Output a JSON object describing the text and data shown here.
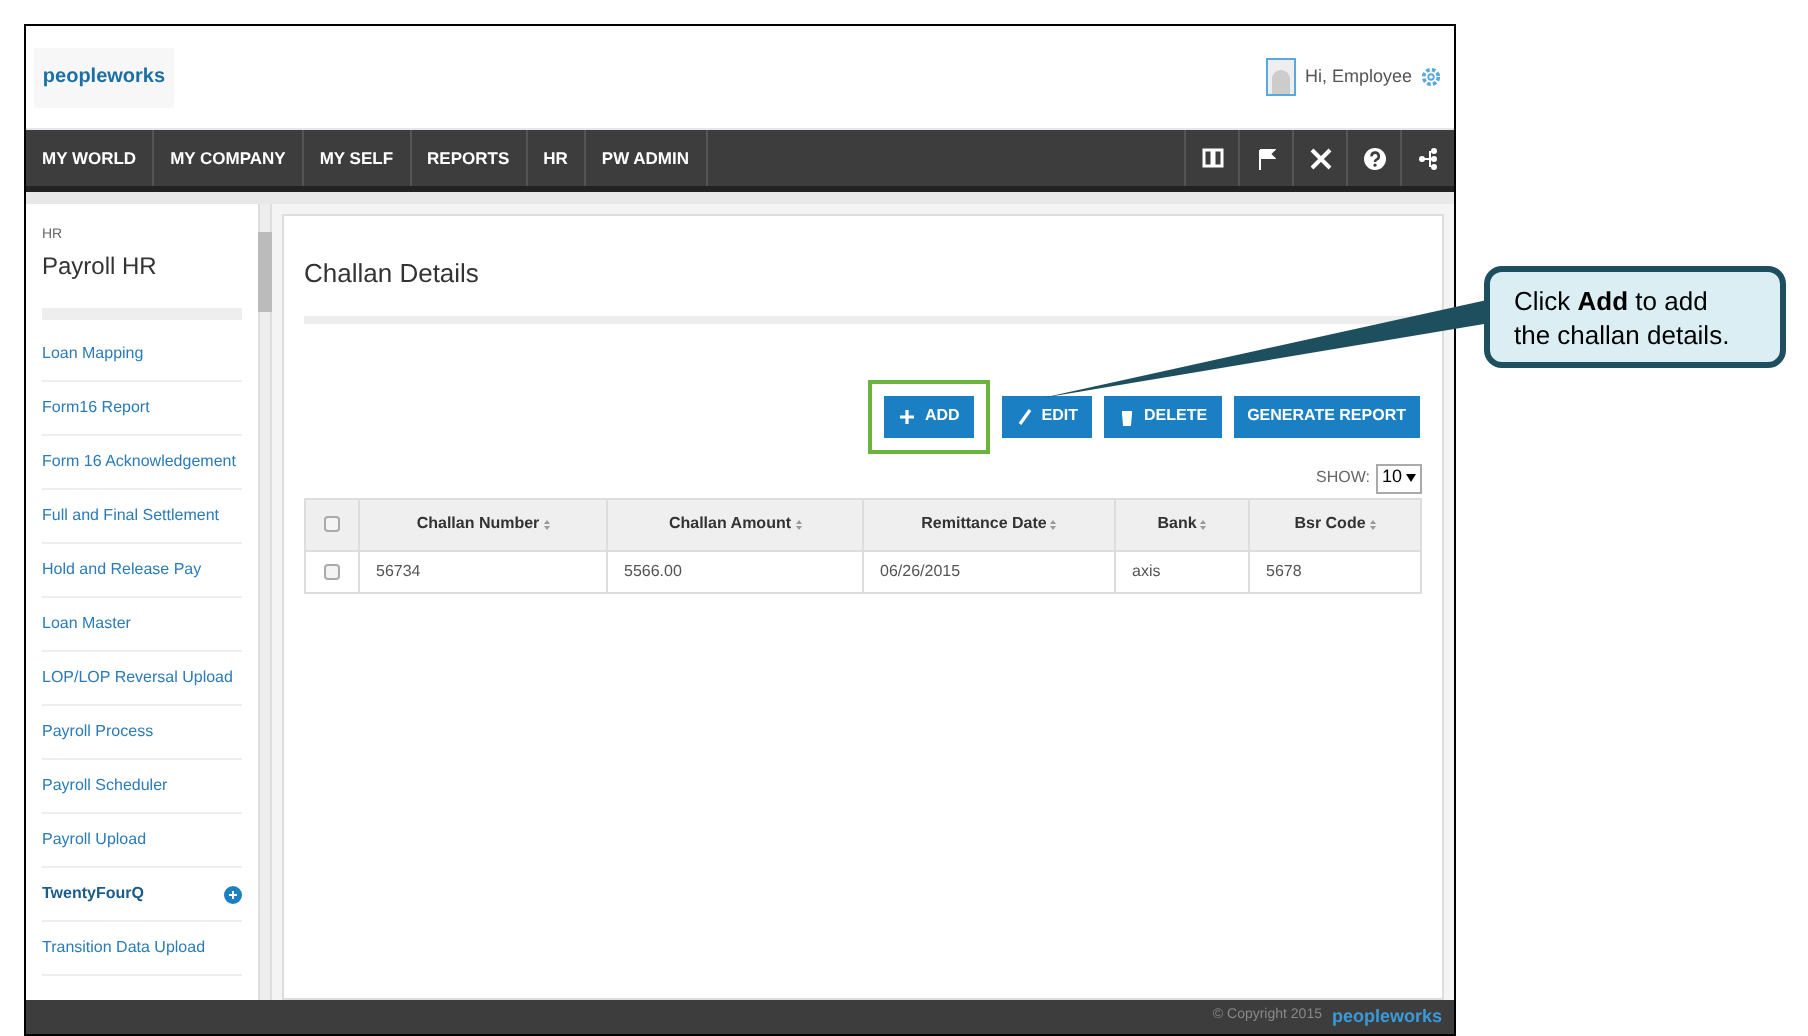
{
  "header": {
    "logo": "peopleworks",
    "greeting": "Hi, Employee"
  },
  "nav": {
    "items": [
      {
        "label": "MY WORLD"
      },
      {
        "label": "MY COMPANY"
      },
      {
        "label": "MY SELF"
      },
      {
        "label": "REPORTS"
      },
      {
        "label": "HR"
      },
      {
        "label": "PW ADMIN"
      }
    ]
  },
  "sidebar": {
    "section": "HR",
    "title": "Payroll HR",
    "items": [
      {
        "label": "Loan Mapping",
        "selected": false
      },
      {
        "label": "Form16 Report",
        "selected": false
      },
      {
        "label": "Form 16 Acknowledgement",
        "selected": false
      },
      {
        "label": "Full and Final Settlement",
        "selected": false
      },
      {
        "label": "Hold and Release Pay",
        "selected": false
      },
      {
        "label": "Loan Master",
        "selected": false
      },
      {
        "label": "LOP/LOP Reversal Upload",
        "selected": false
      },
      {
        "label": "Payroll Process",
        "selected": false
      },
      {
        "label": "Payroll Scheduler",
        "selected": false
      },
      {
        "label": "Payroll Upload",
        "selected": false
      },
      {
        "label": "TwentyFourQ",
        "selected": true
      },
      {
        "label": "Transition Data Upload",
        "selected": false
      }
    ]
  },
  "content": {
    "title": "Challan Details",
    "buttons": [
      {
        "label": "ADD",
        "kind": "add",
        "highlighted": true
      },
      {
        "label": "EDIT",
        "kind": "edit",
        "highlighted": false
      },
      {
        "label": "DELETE",
        "kind": "delete",
        "highlighted": false
      },
      {
        "label": "GENERATE REPORT",
        "kind": "report",
        "highlighted": false
      }
    ],
    "show": {
      "label": "SHOW:",
      "value": "10"
    },
    "table": {
      "select_all_checked": false,
      "columns": [
        "Challan Number",
        "Challan Amount",
        "Remittance Date",
        "Bank",
        "Bsr Code"
      ],
      "rows": [
        {
          "checked": false,
          "cells": [
            "56734",
            "5566.00",
            "06/26/2015",
            "axis",
            "5678"
          ]
        }
      ]
    }
  },
  "footer": {
    "copyright": "© Copyright 2015",
    "logo": "peopleworks"
  },
  "callout": {
    "text": "Click **Add** to add the challan details."
  }
}
